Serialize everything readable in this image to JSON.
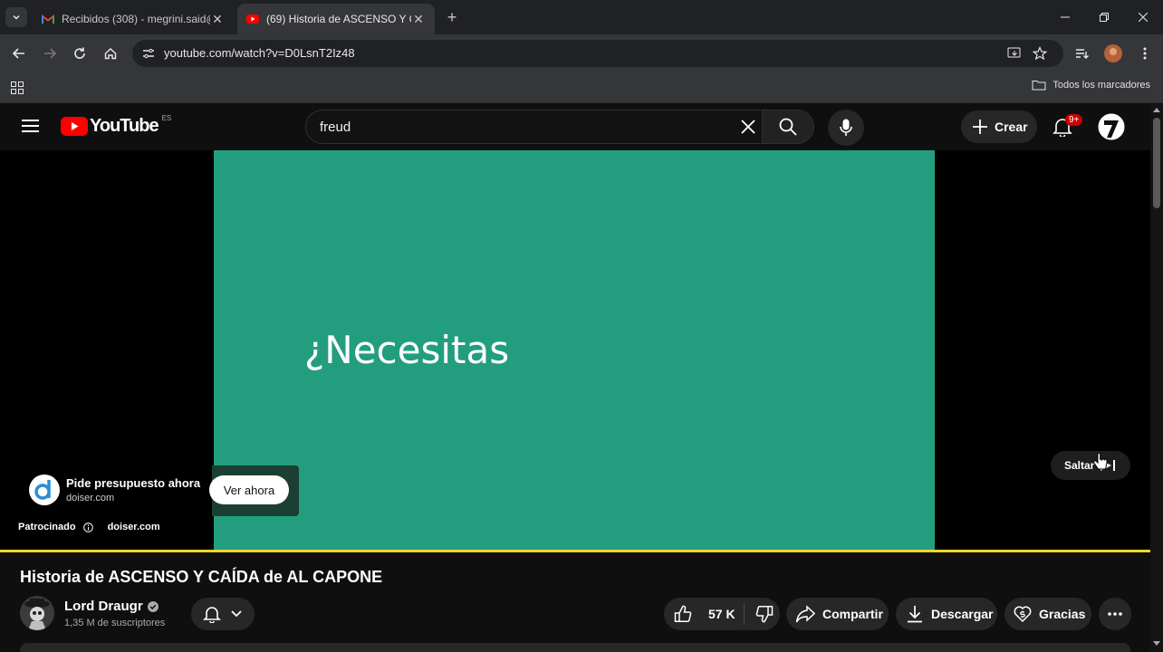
{
  "browser": {
    "tabs": [
      {
        "title": "Recibidos (308) - megrini.said@",
        "favicon": "gmail-icon"
      },
      {
        "title": "(69) Historia de ASCENSO Y CA",
        "favicon": "youtube-icon"
      }
    ],
    "url": "youtube.com/watch?v=D0LsnT2Iz48",
    "bookmarks_label": "Todos los marcadores"
  },
  "youtube": {
    "logo_text": "YouTube",
    "region": "ES",
    "search_query": "freud",
    "create_label": "Crear",
    "notification_count": "9+"
  },
  "player": {
    "video_text": "¿Necesitas",
    "ad": {
      "title": "Pide presupuesto ahora",
      "domain": "doiser.com",
      "cta": "Ver ahora",
      "sponsored_label": "Patrocinado",
      "sponsor_domain": "doiser.com"
    },
    "skip_label": "Saltar"
  },
  "video": {
    "title": "Historia de ASCENSO Y CAÍDA de AL CAPONE",
    "channel": "Lord Draugr",
    "subscribers": "1,35 M de suscriptores",
    "likes": "57 K",
    "share_label": "Compartir",
    "download_label": "Descargar",
    "thanks_label": "Gracias"
  },
  "colors": {
    "video_bg": "#229e7f",
    "progress": "#f2d531",
    "yt_red": "#ff0000"
  }
}
